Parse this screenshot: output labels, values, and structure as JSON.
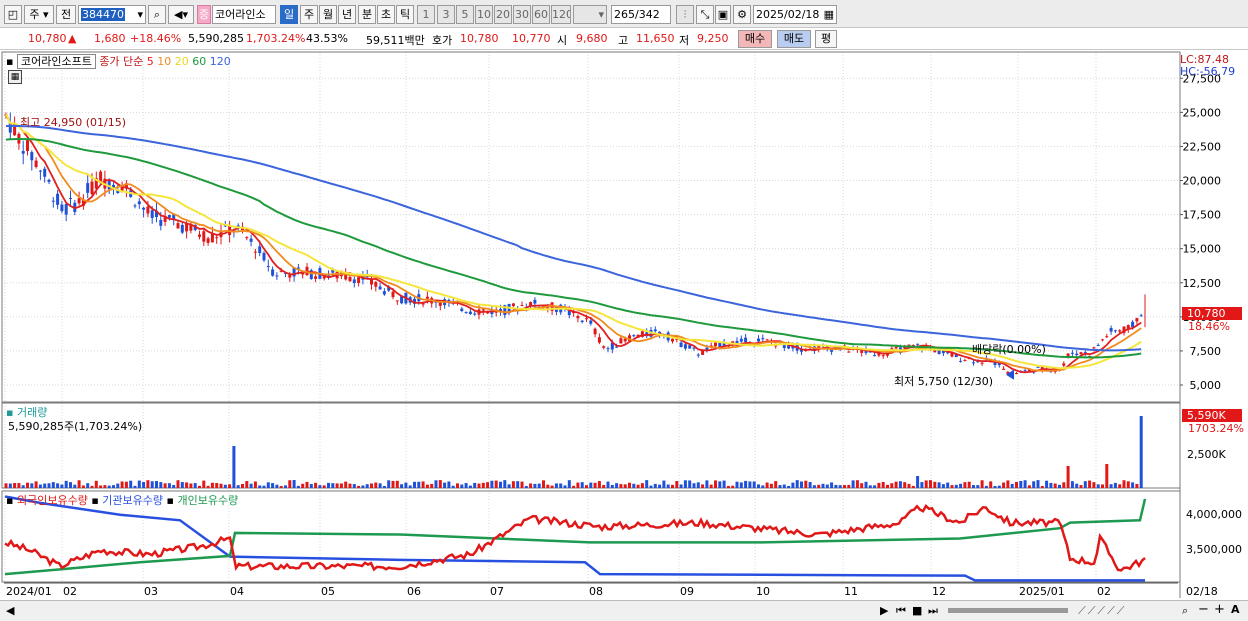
{
  "toolbar": {
    "period_type": "주",
    "scope": "전",
    "code": "384470",
    "stock_name": "코어라인소",
    "badge": "증",
    "period_buttons": [
      "일",
      "주",
      "월",
      "년",
      "분",
      "초",
      "틱"
    ],
    "interval_buttons": [
      "1",
      "3",
      "5",
      "10",
      "20",
      "30",
      "60",
      "120"
    ],
    "count": "265",
    "count_total": "/342",
    "date": "2025/02/18"
  },
  "quote": {
    "price": "10,780",
    "change": "1,680",
    "change_pct": "+18.46%",
    "volume": "5,590,285",
    "volume_pct": "1,703.24%",
    "turnover": "43.53%",
    "amount": "59,511백만",
    "ask_label": "호가",
    "ask_1": "10,780",
    "ask_2": "10,770",
    "open_label": "시",
    "open": "9,680",
    "high_label": "고",
    "high": "11,650",
    "low_label": "저",
    "low": "9,250",
    "buy_label": "매수",
    "sell_label": "매도",
    "eval_label": "평"
  },
  "price_panel": {
    "stock_tag": "코어라인소프트",
    "indicator": "종가 단순",
    "ma_periods": [
      "5",
      "10",
      "20",
      "60",
      "120"
    ],
    "ma_colors": [
      "#e02020",
      "#f08c1e",
      "#f5e63c",
      "#1e9a3c",
      "#3c64dc"
    ],
    "lc": "LC:87.48",
    "hc": "HC:-56.79",
    "high_marker": "최고 24,950 (01/15)",
    "low_marker": "최저 5,750 (12/30)",
    "ex_dividend": "배당락(0.00%)",
    "last_price": "10,780",
    "last_pct": "18.46%",
    "y_ticks": [
      "27,500",
      "25,000",
      "22,500",
      "20,000",
      "17,500",
      "15,000",
      "12,500",
      "10,000",
      "7,500",
      "5,000"
    ]
  },
  "volume_panel": {
    "title": "거래량",
    "value": "5,590,285주(1,703.24%)",
    "last": "5,590K",
    "last_pct": "1703.24%",
    "y_tick": "2,500K"
  },
  "holding_panel": {
    "series_names": [
      "외국인보유수량",
      "기관보유수량",
      "개인보유수량"
    ],
    "series_colors": [
      "#e01818",
      "#2850e0",
      "#1e9a50"
    ],
    "y_ticks": [
      "4,000,000",
      "3,500,000"
    ]
  },
  "x_axis": {
    "labels": [
      "2024/01",
      "02",
      "03",
      "04",
      "05",
      "06",
      "07",
      "08",
      "09",
      "10",
      "11",
      "12",
      "2025/01",
      "02"
    ],
    "right_label": "02/18"
  }
}
